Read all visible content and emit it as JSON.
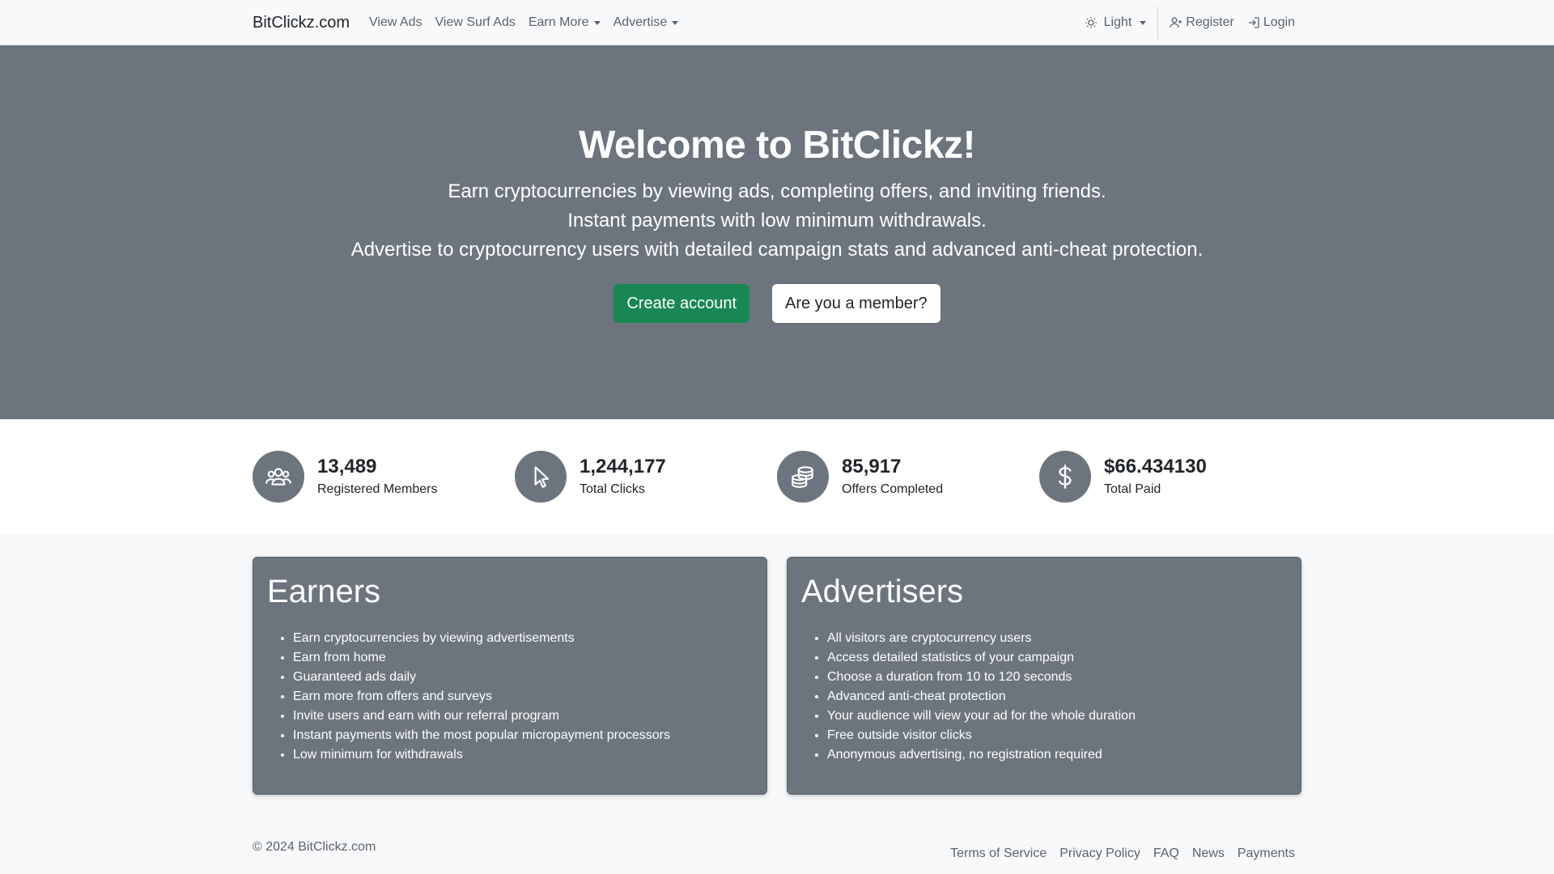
{
  "navbar": {
    "brand": "BitClickz.com",
    "links": [
      {
        "label": "View Ads"
      },
      {
        "label": "View Surf Ads"
      },
      {
        "label": "Earn More"
      },
      {
        "label": "Advertise"
      }
    ],
    "theme_label": "Light",
    "register_label": "Register",
    "login_label": "Login"
  },
  "hero": {
    "title": "Welcome to BitClickz!",
    "lines": [
      "Earn cryptocurrencies by viewing ads, completing offers, and inviting friends.",
      "Instant payments with low minimum withdrawals.",
      "Advertise to cryptocurrency users with detailed campaign stats and advanced anti-cheat protection."
    ],
    "create_button": "Create account",
    "member_button": "Are you a member?"
  },
  "stats": [
    {
      "icon": "users-icon",
      "value": "13,489",
      "label": "Registered Members"
    },
    {
      "icon": "cursor-icon",
      "value": "1,244,177",
      "label": "Total Clicks"
    },
    {
      "icon": "coins-icon",
      "value": "85,917",
      "label": "Offers Completed"
    },
    {
      "icon": "dollar-icon",
      "value": "$66.434130",
      "label": "Total Paid"
    }
  ],
  "earners": {
    "title": "Earners",
    "items": [
      "Earn cryptocurrencies by viewing advertisements",
      "Earn from home",
      "Guaranteed ads daily",
      "Earn more from offers and surveys",
      "Invite users and earn with our referral program",
      "Instant payments with the most popular micropayment processors",
      "Low minimum for withdrawals"
    ]
  },
  "advertisers": {
    "title": "Advertisers",
    "items": [
      "All visitors are cryptocurrency users",
      "Access detailed statistics of your campaign",
      "Choose a duration from 10 to 120 seconds",
      "Advanced anti-cheat protection",
      "Your audience will view your ad for the whole duration",
      "Free outside visitor clicks",
      "Anonymous advertising, no registration required"
    ]
  },
  "footer": {
    "copyright": "© 2024 BitClickz.com",
    "links": [
      "Terms of Service",
      "Privacy Policy",
      "FAQ",
      "News",
      "Payments"
    ]
  },
  "colors": {
    "hero_bg": "#6c757d",
    "success": "#198754",
    "card_bg": "#6c757d"
  }
}
